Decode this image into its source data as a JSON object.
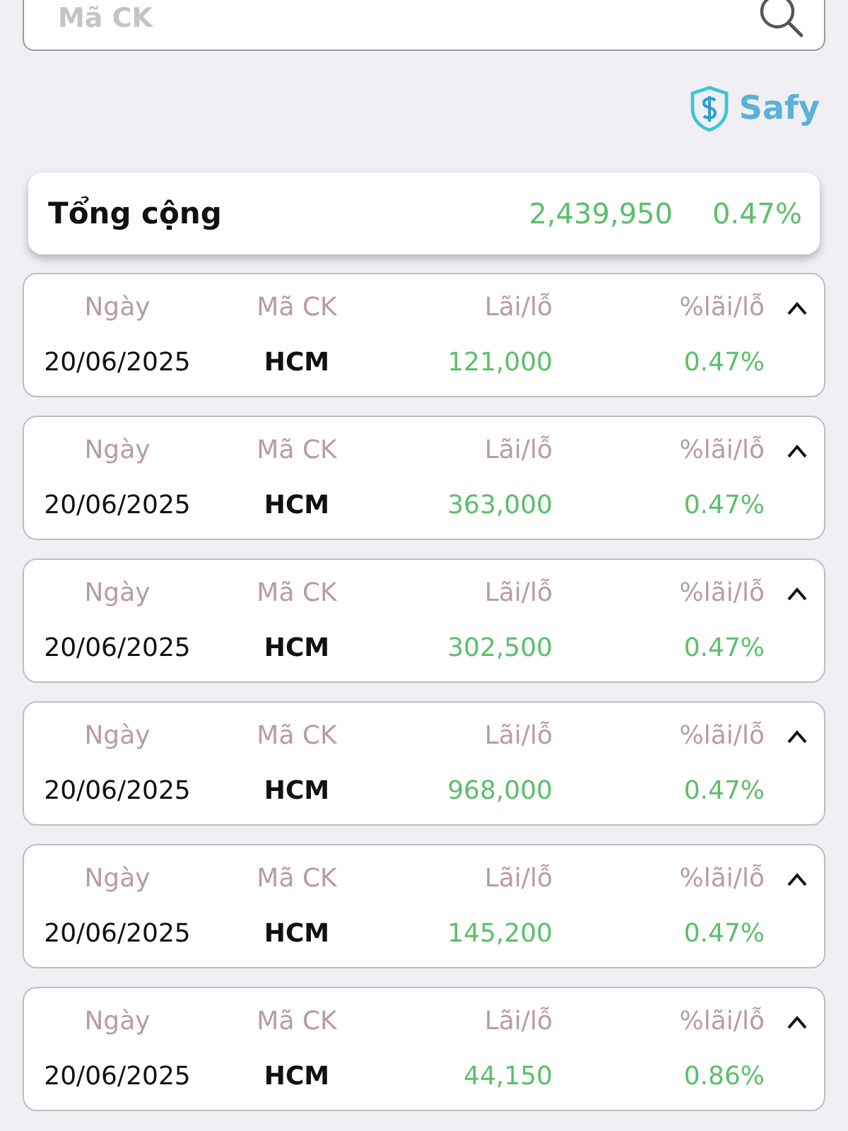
{
  "search": {
    "placeholder": "Mã CK"
  },
  "brand": {
    "name": "Safy"
  },
  "total": {
    "label": "Tổng cộng",
    "amount": "2,439,950",
    "percent": "0.47%"
  },
  "trades": [
    {
      "headers": [
        "Ngày",
        "Mã CK",
        "Lãi/lỗ",
        "%lãi/lỗ"
      ],
      "date": "20/06/2025",
      "symbol": "HCM",
      "profit": "121,000",
      "percent": "0.47%",
      "expanded": true
    },
    {
      "headers": [
        "Ngày",
        "Mã CK",
        "Lãi/lỗ",
        "%lãi/lỗ"
      ],
      "date": "20/06/2025",
      "symbol": "HCM",
      "profit": "363,000",
      "percent": "0.47%",
      "expanded": true
    },
    {
      "headers": [
        "Ngày",
        "Mã CK",
        "Lãi/lỗ",
        "%lãi/lỗ"
      ],
      "date": "20/06/2025",
      "symbol": "HCM",
      "profit": "302,500",
      "percent": "0.47%",
      "expanded": true
    },
    {
      "headers": [
        "Ngày",
        "Mã CK",
        "Lãi/lỗ",
        "%lãi/lỗ"
      ],
      "date": "20/06/2025",
      "symbol": "HCM",
      "profit": "968,000",
      "percent": "0.47%",
      "expanded": true
    },
    {
      "headers": [
        "Ngày",
        "Mã CK",
        "Lãi/lỗ",
        "%lãi/lỗ"
      ],
      "date": "20/06/2025",
      "symbol": "HCM",
      "profit": "145,200",
      "percent": "0.47%",
      "expanded": true
    },
    {
      "headers": [
        "Ngày",
        "Mã CK",
        "Lãi/lỗ",
        "%lãi/lỗ"
      ],
      "date": "20/06/2025",
      "symbol": "HCM",
      "profit": "44,150",
      "percent": "0.86%",
      "expanded": true
    }
  ]
}
